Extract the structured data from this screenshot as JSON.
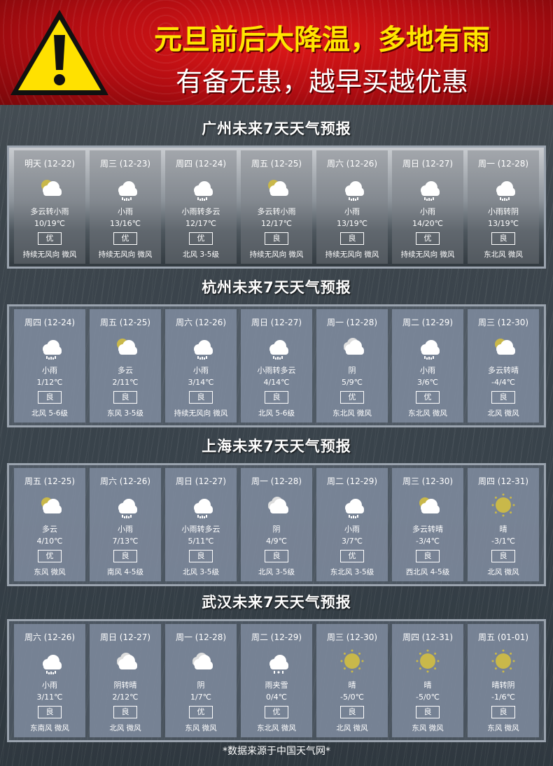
{
  "header": {
    "line1": "元旦前后大降温，多地有雨",
    "line2": "有备无患，越早买越优惠"
  },
  "sections": [
    {
      "title": "广州未来7天天气预报",
      "days": [
        {
          "date": "明天 (12-22)",
          "icon": "partly-cloudy",
          "desc": "多云转小雨",
          "temp": "10/19℃",
          "aq": "优",
          "wind": "持续无风向 微风"
        },
        {
          "date": "周三 (12-23)",
          "icon": "rain",
          "desc": "小雨",
          "temp": "13/16℃",
          "aq": "优",
          "wind": "持续无风向 微风"
        },
        {
          "date": "周四 (12-24)",
          "icon": "rain",
          "desc": "小雨转多云",
          "temp": "12/17℃",
          "aq": "优",
          "wind": "北风 3-5级"
        },
        {
          "date": "周五 (12-25)",
          "icon": "partly-cloudy",
          "desc": "多云转小雨",
          "temp": "12/17℃",
          "aq": "良",
          "wind": "持续无风向 微风"
        },
        {
          "date": "周六 (12-26)",
          "icon": "rain",
          "desc": "小雨",
          "temp": "13/19℃",
          "aq": "良",
          "wind": "持续无风向 微风"
        },
        {
          "date": "周日 (12-27)",
          "icon": "rain",
          "desc": "小雨",
          "temp": "14/20℃",
          "aq": "优",
          "wind": "持续无风向 微风"
        },
        {
          "date": "周一 (12-28)",
          "icon": "rain",
          "desc": "小雨转阴",
          "temp": "13/19℃",
          "aq": "良",
          "wind": "东北风 微风"
        }
      ]
    },
    {
      "title": "杭州未来7天天气预报",
      "days": [
        {
          "date": "周四 (12-24)",
          "icon": "rain",
          "desc": "小雨",
          "temp": "1/12℃",
          "aq": "良",
          "wind": "北风 5-6级"
        },
        {
          "date": "周五 (12-25)",
          "icon": "partly-cloudy",
          "desc": "多云",
          "temp": "2/11℃",
          "aq": "良",
          "wind": "东风 3-5级"
        },
        {
          "date": "周六 (12-26)",
          "icon": "rain",
          "desc": "小雨",
          "temp": "3/14℃",
          "aq": "良",
          "wind": "持续无风向 微风"
        },
        {
          "date": "周日 (12-27)",
          "icon": "rain",
          "desc": "小雨转多云",
          "temp": "4/14℃",
          "aq": "良",
          "wind": "北风 5-6级"
        },
        {
          "date": "周一 (12-28)",
          "icon": "cloudy",
          "desc": "阴",
          "temp": "5/9℃",
          "aq": "优",
          "wind": "东北风 微风"
        },
        {
          "date": "周二 (12-29)",
          "icon": "rain",
          "desc": "小雨",
          "temp": "3/6℃",
          "aq": "优",
          "wind": "东北风 微风"
        },
        {
          "date": "周三 (12-30)",
          "icon": "partly-cloudy",
          "desc": "多云转晴",
          "temp": "-4/4℃",
          "aq": "良",
          "wind": "北风 微风"
        }
      ]
    },
    {
      "title": "上海未来7天天气预报",
      "days": [
        {
          "date": "周五 (12-25)",
          "icon": "partly-cloudy",
          "desc": "多云",
          "temp": "4/10℃",
          "aq": "优",
          "wind": "东风 微风"
        },
        {
          "date": "周六 (12-26)",
          "icon": "rain",
          "desc": "小雨",
          "temp": "7/13℃",
          "aq": "良",
          "wind": "南风 4-5级"
        },
        {
          "date": "周日 (12-27)",
          "icon": "rain",
          "desc": "小雨转多云",
          "temp": "5/11℃",
          "aq": "良",
          "wind": "北风 3-5级"
        },
        {
          "date": "周一 (12-28)",
          "icon": "cloudy",
          "desc": "阴",
          "temp": "4/9℃",
          "aq": "良",
          "wind": "北风 3-5级"
        },
        {
          "date": "周二 (12-29)",
          "icon": "rain",
          "desc": "小雨",
          "temp": "3/7℃",
          "aq": "优",
          "wind": "东北风 3-5级"
        },
        {
          "date": "周三 (12-30)",
          "icon": "partly-cloudy",
          "desc": "多云转晴",
          "temp": "-3/4℃",
          "aq": "良",
          "wind": "西北风 4-5级"
        },
        {
          "date": "周四 (12-31)",
          "icon": "sunny",
          "desc": "晴",
          "temp": "-3/1℃",
          "aq": "良",
          "wind": "北风 微风"
        }
      ]
    },
    {
      "title": "武汉未来7天天气预报",
      "days": [
        {
          "date": "周六 (12-26)",
          "icon": "rain",
          "desc": "小雨",
          "temp": "3/11℃",
          "aq": "良",
          "wind": "东南风 微风"
        },
        {
          "date": "周日 (12-27)",
          "icon": "cloudy",
          "desc": "阴转晴",
          "temp": "2/12℃",
          "aq": "良",
          "wind": "北风 微风"
        },
        {
          "date": "周一 (12-28)",
          "icon": "cloudy",
          "desc": "阴",
          "temp": "1/7℃",
          "aq": "优",
          "wind": "东风 微风"
        },
        {
          "date": "周二 (12-29)",
          "icon": "rain-snow",
          "desc": "雨夹雪",
          "temp": "0/4℃",
          "aq": "优",
          "wind": "东北风 微风"
        },
        {
          "date": "周三 (12-30)",
          "icon": "sunny",
          "desc": "晴",
          "temp": "-5/0℃",
          "aq": "良",
          "wind": "北风 微风"
        },
        {
          "date": "周四 (12-31)",
          "icon": "sunny",
          "desc": "晴",
          "temp": "-5/0℃",
          "aq": "良",
          "wind": "东风 微风"
        },
        {
          "date": "周五 (01-01)",
          "icon": "sunny",
          "desc": "晴转阴",
          "temp": "-1/6℃",
          "aq": "良",
          "wind": "东风 微风"
        }
      ]
    }
  ],
  "footer": {
    "source": "*数据来源于中国天气网*"
  },
  "colors": {
    "banner_red": "#c8101a",
    "headline_yellow": "#ffe500",
    "warning_yellow": "#ffe100",
    "sun": "#c9b84a"
  }
}
